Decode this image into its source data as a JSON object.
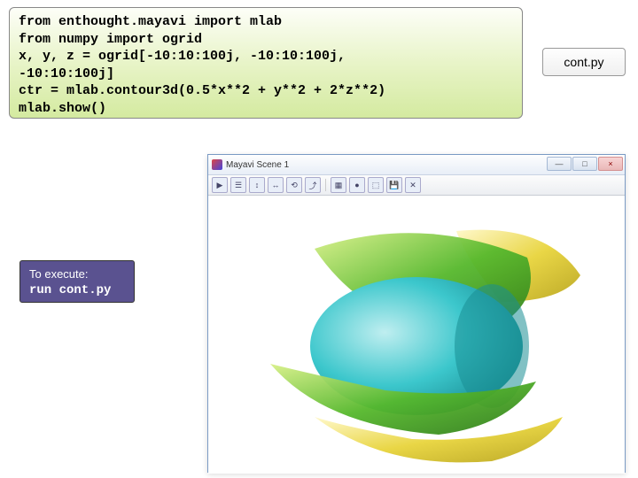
{
  "code": {
    "text": "from enthought.mayavi import mlab\nfrom numpy import ogrid\nx, y, z = ogrid[-10:10:100j, -10:10:100j,\n-10:10:100j]\nctr = mlab.contour3d(0.5*x**2 + y**2 + 2*z**2)\nmlab.show()"
  },
  "filename": "cont.py",
  "execute": {
    "label": "To execute:",
    "command": "run cont.py"
  },
  "mayavi_window": {
    "title": "Mayavi Scene 1",
    "controls": {
      "min": "—",
      "max": "□",
      "close": "×"
    },
    "toolbar": [
      "▶",
      "☰",
      "↕",
      "↔",
      "⟲",
      "⤴",
      "",
      "▦",
      "●",
      "⬚",
      "💾",
      "✕"
    ]
  }
}
